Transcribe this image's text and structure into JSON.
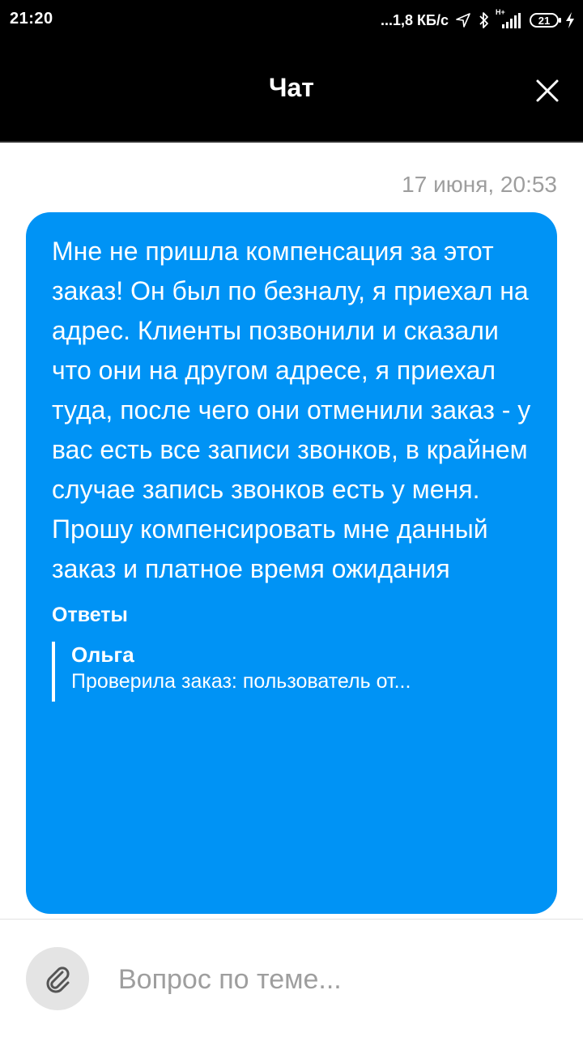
{
  "status_bar": {
    "time": "21:20",
    "network_speed": "...1,8 КБ/с",
    "network_type": "H+",
    "battery": "21"
  },
  "header": {
    "title": "Чат",
    "close_icon": "close-icon"
  },
  "chat": {
    "timestamp": "17 июня, 20:53",
    "message": {
      "text": "Мне не пришла компенсация за этот заказ! Он был по безналу, я приехал на адрес. Клиенты позвонили и сказали что они на другом адресе, я приехал туда, после чего они отменили заказ - у вас есть все записи звонков, в крайнем случае запись звонков есть у меня. Прошу компенсировать мне данный заказ и платное время ожидания",
      "replies_title": "Ответы",
      "replies": [
        {
          "author": "Ольга",
          "preview": "Проверила заказ: пользователь от..."
        }
      ]
    }
  },
  "composer": {
    "attach_icon": "paperclip-icon",
    "placeholder": "Вопрос по теме..."
  },
  "colors": {
    "bubble": "#0093f5",
    "header_bg": "#000000",
    "timestamp": "#9e9e9e",
    "attach_bg": "#e4e4e4"
  }
}
